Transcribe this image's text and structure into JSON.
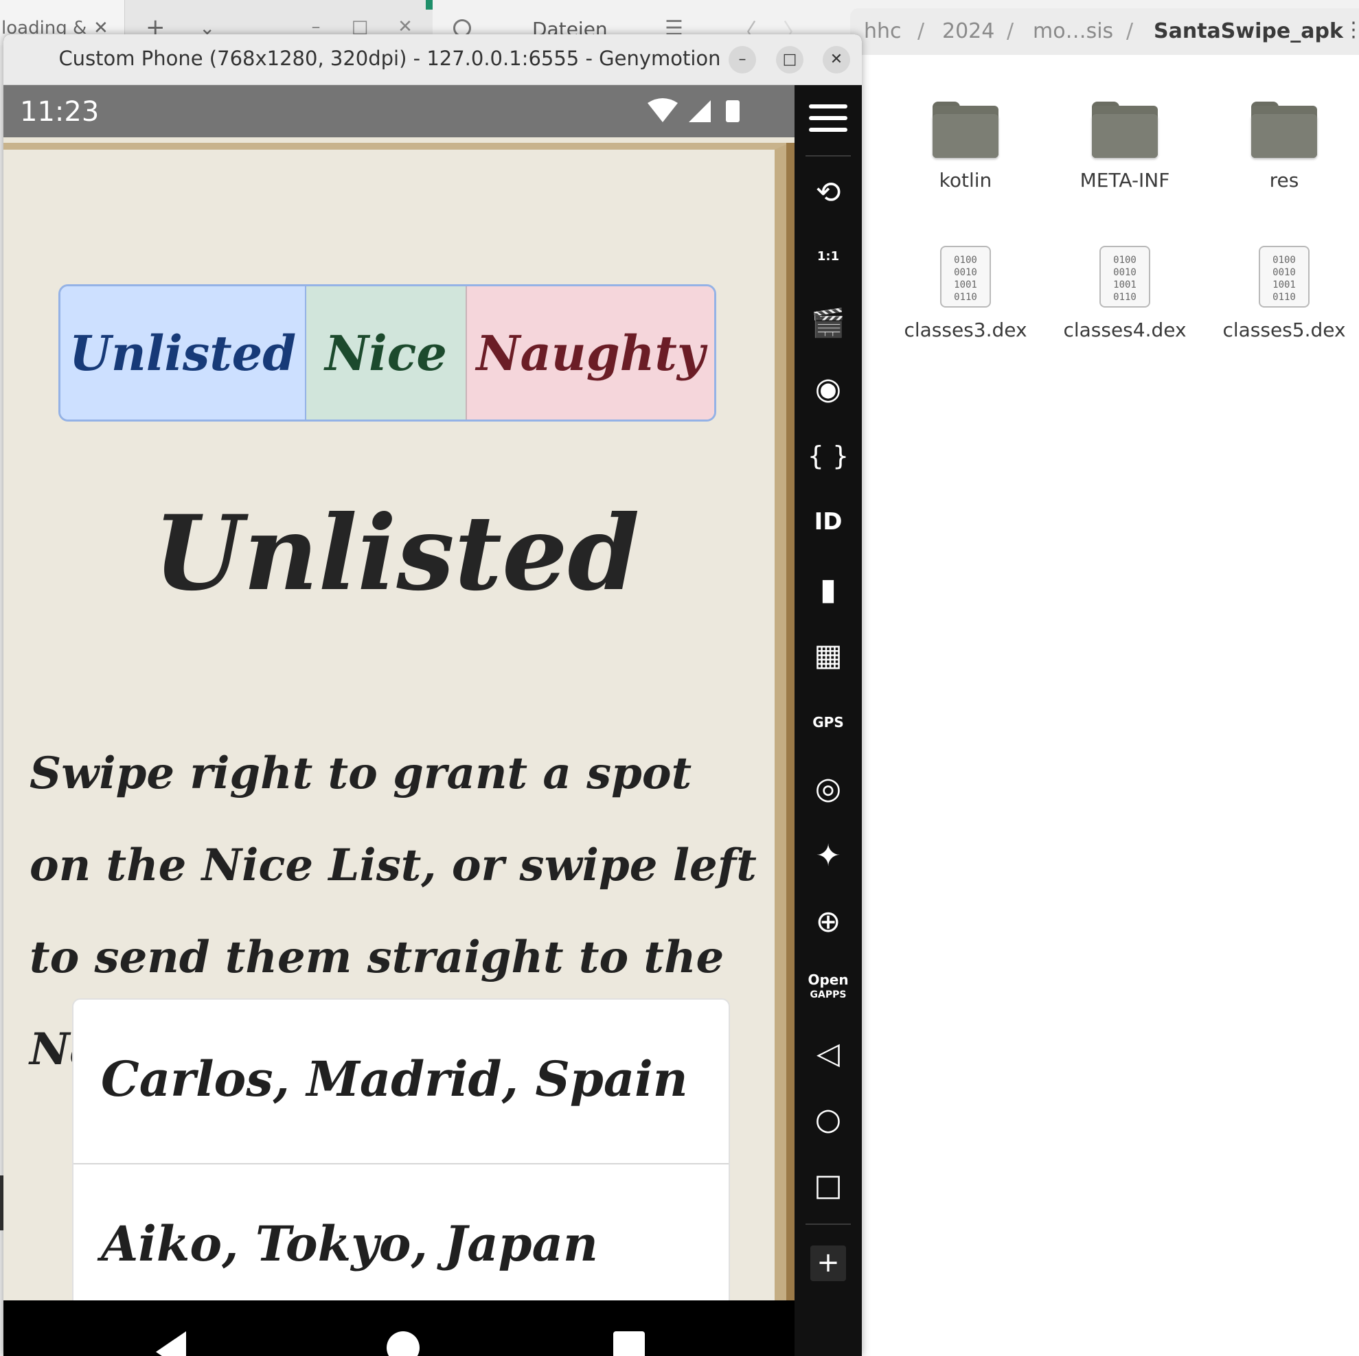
{
  "background_browser": {
    "tab_title": "loading & ",
    "tab_close": "✕",
    "new_tab": "+",
    "tab_list": "⌄",
    "minimize": "–",
    "maximize": "□",
    "close": "✕"
  },
  "file_manager": {
    "title": "Dateien",
    "menu": "☰",
    "back": "〈",
    "forward": "〉",
    "breadcrumbs": [
      "hhc",
      "2024",
      "mo…sis",
      "SantaSwipe_apk"
    ],
    "separator": "/",
    "more": "⋮",
    "folders": [
      "kotlin",
      "META-INF",
      "res"
    ],
    "files": [
      "classes3.dex",
      "classes4.dex",
      "classes5.dex"
    ],
    "binary_glyph": "0100\n0010\n1001\n0110"
  },
  "genymotion": {
    "title": "Custom Phone (768x1280, 320dpi) - 127.0.0.1:6555 - Genymotion",
    "minimize": "–",
    "maximize": "□",
    "close": "✕",
    "sidebar": {
      "rotate": "⟲",
      "pixel_perfect": "1:1",
      "capture": "🎬",
      "broadcast": "◉",
      "code": "{ }",
      "identifiers": "ID",
      "storage": "▮",
      "media": "▦",
      "gps": "GPS",
      "biometrics": "◎",
      "motion": "✦",
      "gamepad": "⊕",
      "opengapps_line1": "Open",
      "opengapps_line2": "GAPPS",
      "back": "◁",
      "home": "○",
      "recents": "□",
      "add": "+"
    }
  },
  "phone": {
    "time": "11:23",
    "tabs": [
      "Unlisted",
      "Nice",
      "Naughty"
    ],
    "heading": "Unlisted",
    "instructions": "Swipe right to grant a spot on the Nice List, or swipe left to send them straight to the Naughty List.",
    "list": [
      "Carlos, Madrid, Spain",
      "Aiko, Tokyo, Japan"
    ]
  },
  "colors": {
    "unlisted_bg": "#cde0ff",
    "nice_bg": "#d1e5db",
    "naughty_bg": "#f5d6db",
    "parchment": "#ece8dd",
    "sidebar": "#111111"
  }
}
